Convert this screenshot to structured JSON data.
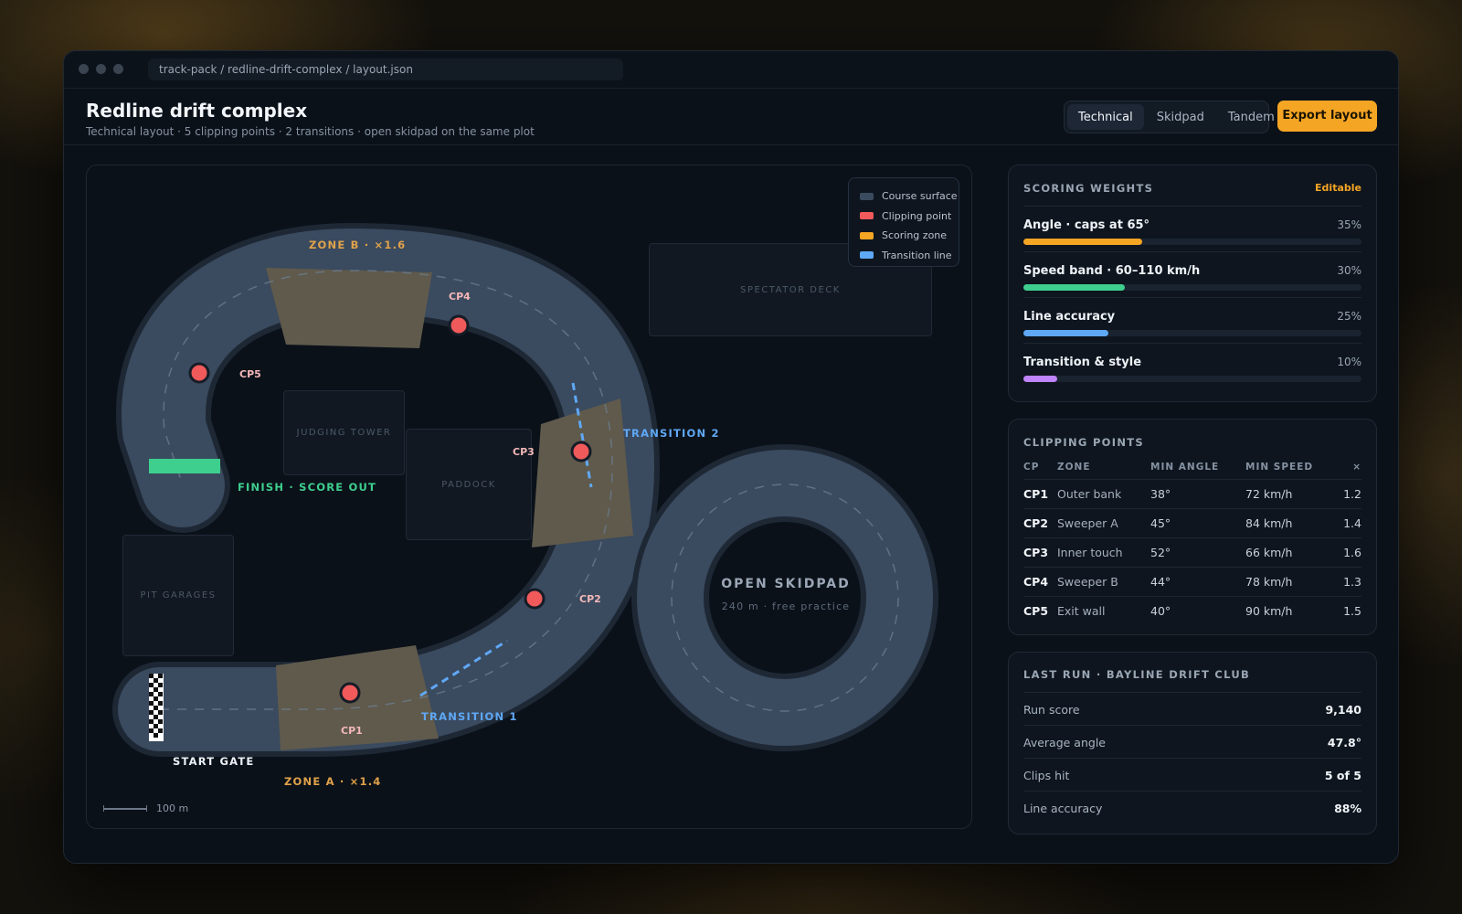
{
  "window": {
    "url": "track-pack / redline-drift-complex / layout.json"
  },
  "header": {
    "title": "Redline drift complex",
    "subtitle": "Technical layout · 5 clipping points · 2 transitions · open skidpad on the same plot",
    "tabs": [
      {
        "label": "Technical",
        "active": true
      },
      {
        "label": "Skidpad",
        "active": false
      },
      {
        "label": "Tandem",
        "active": false
      }
    ],
    "export_label": "Export layout"
  },
  "map": {
    "legend": [
      {
        "label": "Course surface",
        "color": "#3a4a5f"
      },
      {
        "label": "Clipping point",
        "color": "#f05a5a"
      },
      {
        "label": "Scoring zone",
        "color": "#f5a524"
      },
      {
        "label": "Transition line",
        "color": "#5fa8f5"
      }
    ],
    "buildings": {
      "spectator_deck": "SPECTATOR DECK",
      "judging_tower": "JUDGING TOWER",
      "paddock": "PADDOCK",
      "pit_garages": "PIT GARAGES"
    },
    "labels": {
      "zone_b": "ZONE B · ×1.6",
      "zone_a": "ZONE A · ×1.4",
      "finish": "FINISH · SCORE OUT",
      "start": "START GATE",
      "transition_1": "TRANSITION 1",
      "transition_2": "TRANSITION 2"
    },
    "clipping_points": [
      "CP1",
      "CP2",
      "CP3",
      "CP4",
      "CP5"
    ],
    "skidpad": {
      "title": "OPEN SKIDPAD",
      "subtitle": "240 m · free practice"
    },
    "scale_label": "100 m",
    "colors": {
      "surface": "#3a4a5f",
      "zone": "#5f5a4c",
      "finish": "#3ecf8e"
    }
  },
  "scoring": {
    "heading": "SCORING WEIGHTS",
    "editable_label": "Editable",
    "weights": [
      {
        "name": "Angle · caps at 65°",
        "percent_label": "35%",
        "value": 35,
        "color": "#f5a524"
      },
      {
        "name": "Speed band · 60–110 km/h",
        "percent_label": "30%",
        "value": 30,
        "color": "#3ecf8e"
      },
      {
        "name": "Line accuracy",
        "percent_label": "25%",
        "value": 25,
        "color": "#5fa8f5"
      },
      {
        "name": "Transition & style",
        "percent_label": "10%",
        "value": 10,
        "color": "#c084fc"
      }
    ]
  },
  "clipping_table": {
    "heading": "CLIPPING POINTS",
    "columns": [
      "CP",
      "ZONE",
      "MIN ANGLE",
      "MIN SPEED",
      "×"
    ],
    "rows": [
      [
        "CP1",
        "Outer bank",
        "38°",
        "72 km/h",
        "1.2"
      ],
      [
        "CP2",
        "Sweeper A",
        "45°",
        "84 km/h",
        "1.4"
      ],
      [
        "CP3",
        "Inner touch",
        "52°",
        "66 km/h",
        "1.6"
      ],
      [
        "CP4",
        "Sweeper B",
        "44°",
        "78 km/h",
        "1.3"
      ],
      [
        "CP5",
        "Exit wall",
        "40°",
        "90 km/h",
        "1.5"
      ]
    ]
  },
  "last_run": {
    "heading": "LAST RUN · BAYLINE DRIFT CLUB",
    "stats": [
      {
        "label": "Run score",
        "value": "9,140"
      },
      {
        "label": "Average angle",
        "value": "47.8°"
      },
      {
        "label": "Clips hit",
        "value": "5 of 5"
      },
      {
        "label": "Line accuracy",
        "value": "88%"
      }
    ]
  }
}
